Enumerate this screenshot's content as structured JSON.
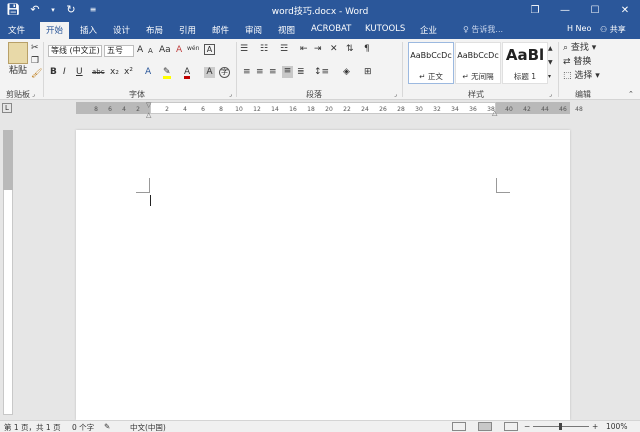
{
  "window": {
    "title": "word技巧.docx - Word",
    "controls": {
      "restore": "❐",
      "minimize": "—",
      "maximize": "☐",
      "close": "✕"
    }
  },
  "qat": {
    "save_icon": "save-icon",
    "undo_icon": "undo-icon",
    "redo_icon": "redo-icon",
    "customize_icon": "customize-icon"
  },
  "tabs": [
    "文件",
    "开始",
    "插入",
    "设计",
    "布局",
    "引用",
    "邮件",
    "审阅",
    "视图",
    "ACROBAT",
    "KUTOOLS",
    "企业"
  ],
  "active_tab": "开始",
  "tell_me": "♀ 告诉我...",
  "user": "H Neo",
  "share": "共享",
  "clipboard": {
    "paste": "粘贴",
    "label": "剪贴板"
  },
  "font": {
    "name": "等线 (中文正)",
    "size": "五号",
    "label": "字体",
    "buttons": [
      "B",
      "I",
      "U",
      "abc",
      "x₂",
      "x²"
    ],
    "grow": "A",
    "shrink": "A",
    "aa": "Aa",
    "clear": "A",
    "wen": "wén",
    "frame": "A"
  },
  "paragraph": {
    "label": "段落"
  },
  "styles": {
    "label": "样式",
    "items": [
      {
        "sample": "AaBbCcDc",
        "name": "↵ 正文"
      },
      {
        "sample": "AaBbCcDc",
        "name": "↵ 无间隔"
      },
      {
        "sample": "AaBl",
        "name": "标题 1"
      }
    ]
  },
  "editing": {
    "label": "编辑",
    "find": "查找",
    "replace": "替换",
    "select": "选择"
  },
  "ruler_ticks": [
    "8",
    "6",
    "4",
    "2",
    "2",
    "4",
    "6",
    "8",
    "10",
    "12",
    "14",
    "16",
    "18",
    "20",
    "22",
    "24",
    "26",
    "28",
    "30",
    "32",
    "34",
    "36",
    "38",
    "40",
    "42",
    "44",
    "46",
    "48"
  ],
  "status": {
    "page": "第 1 页，共 1 页",
    "words": "0 个字",
    "language": "中文(中国)",
    "zoom": "100%",
    "zoom_minus": "−",
    "zoom_plus": "+"
  },
  "colors": {
    "accent": "#2b579a",
    "ribbon": "#f3f3f3",
    "canvas": "#e6e6e6",
    "font_color": "#c00000",
    "highlight": "#ffff00"
  }
}
